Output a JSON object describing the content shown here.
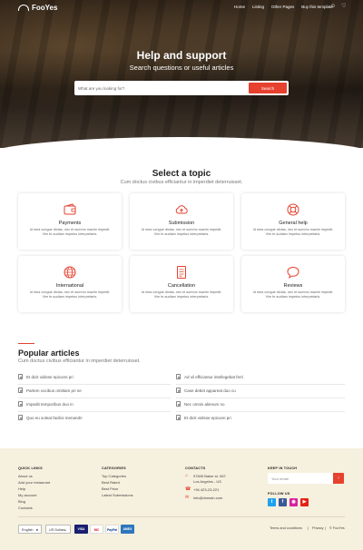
{
  "brand": {
    "name": "FooYes"
  },
  "nav": {
    "items": [
      "Home",
      "Listing",
      "Other Pages",
      "Buy this template"
    ]
  },
  "hero": {
    "title": "Help and support",
    "subtitle": "Search questions or useful articles",
    "search_placeholder": "What are you looking for?",
    "search_button": "Search"
  },
  "topics": {
    "title": "Select a topic",
    "subtitle": "Cum doctus civibus efficiantur in imperdiet deterruisset.",
    "cards": [
      {
        "title": "Payments",
        "icon": "wallet-icon",
        "desc": "Id mea congue dictas, nec et summo mazim impedit. Vim te audiam impetus interpretaris."
      },
      {
        "title": "Submission",
        "icon": "cloud-upload-icon",
        "desc": "Id mea congue dictas, nec et summo mazim impedit. Vim te audiam impetus interpretaris."
      },
      {
        "title": "General help",
        "icon": "lifebuoy-icon",
        "desc": "Id mea congue dictas, nec et summo mazim impedit. Vim te audiam impetus interpretaris."
      },
      {
        "title": "International",
        "icon": "globe-icon",
        "desc": "Id mea congue dictas, nec et summo mazim impedit. Vim te audiam impetus interpretaris."
      },
      {
        "title": "Cancellation",
        "icon": "document-icon",
        "desc": "Id mea congue dictas, nec et summo mazim impedit. Vim te audiam impetus interpretaris."
      },
      {
        "title": "Reviews",
        "icon": "chat-bubble-icon",
        "desc": "Id mea congue dictas, nec et summo mazim impedit. Vim te audiam impetus interpretaris."
      }
    ]
  },
  "popular": {
    "title": "Popular articles",
    "subtitle": "Cum doctus civibus efficiantur in imperdiet deterruisset.",
    "left": [
      "Et dicit vidisse epicurei pri",
      "Partem vocibus omittam pri ne",
      "Impedit temporibus duo in",
      "Quo eu soleat facilisi menandri"
    ],
    "right": [
      "Ad vil efficiantur intellegebat ferri",
      "Case debet appareat duo cu",
      "Nec omnis alienum no",
      "Et dicit vidisse epicurei pri"
    ]
  },
  "footer": {
    "quick_links": {
      "heading": "QUICK LINKS",
      "items": [
        "About us",
        "Add your restaurant",
        "Help",
        "My account",
        "Blog",
        "Contacts"
      ]
    },
    "categories": {
      "heading": "CATEGORIES",
      "items": [
        "Top Categories",
        "Best Rated",
        "Best Price",
        "Latest Submissions"
      ]
    },
    "contacts": {
      "heading": "CONTACTS",
      "address_line1": "97845 Baker st. 567",
      "address_line2": "Los Angeles - US",
      "phone": "+94 423-23-221",
      "email": "info@domain.com"
    },
    "newsletter": {
      "heading": "KEEP IN TOUCH",
      "placeholder": "Your email",
      "button": "›"
    },
    "follow": {
      "heading": "FOLLOW US"
    },
    "language": "English",
    "currency": "US Dollars",
    "payments": [
      "VISA",
      "MC",
      "PayPal",
      "AMEX"
    ],
    "bottom_links": [
      "Terms and conditions",
      "Privacy",
      "© FooYes"
    ]
  },
  "colors": {
    "accent": "#e6412f",
    "footer_bg": "#f6f0de"
  }
}
